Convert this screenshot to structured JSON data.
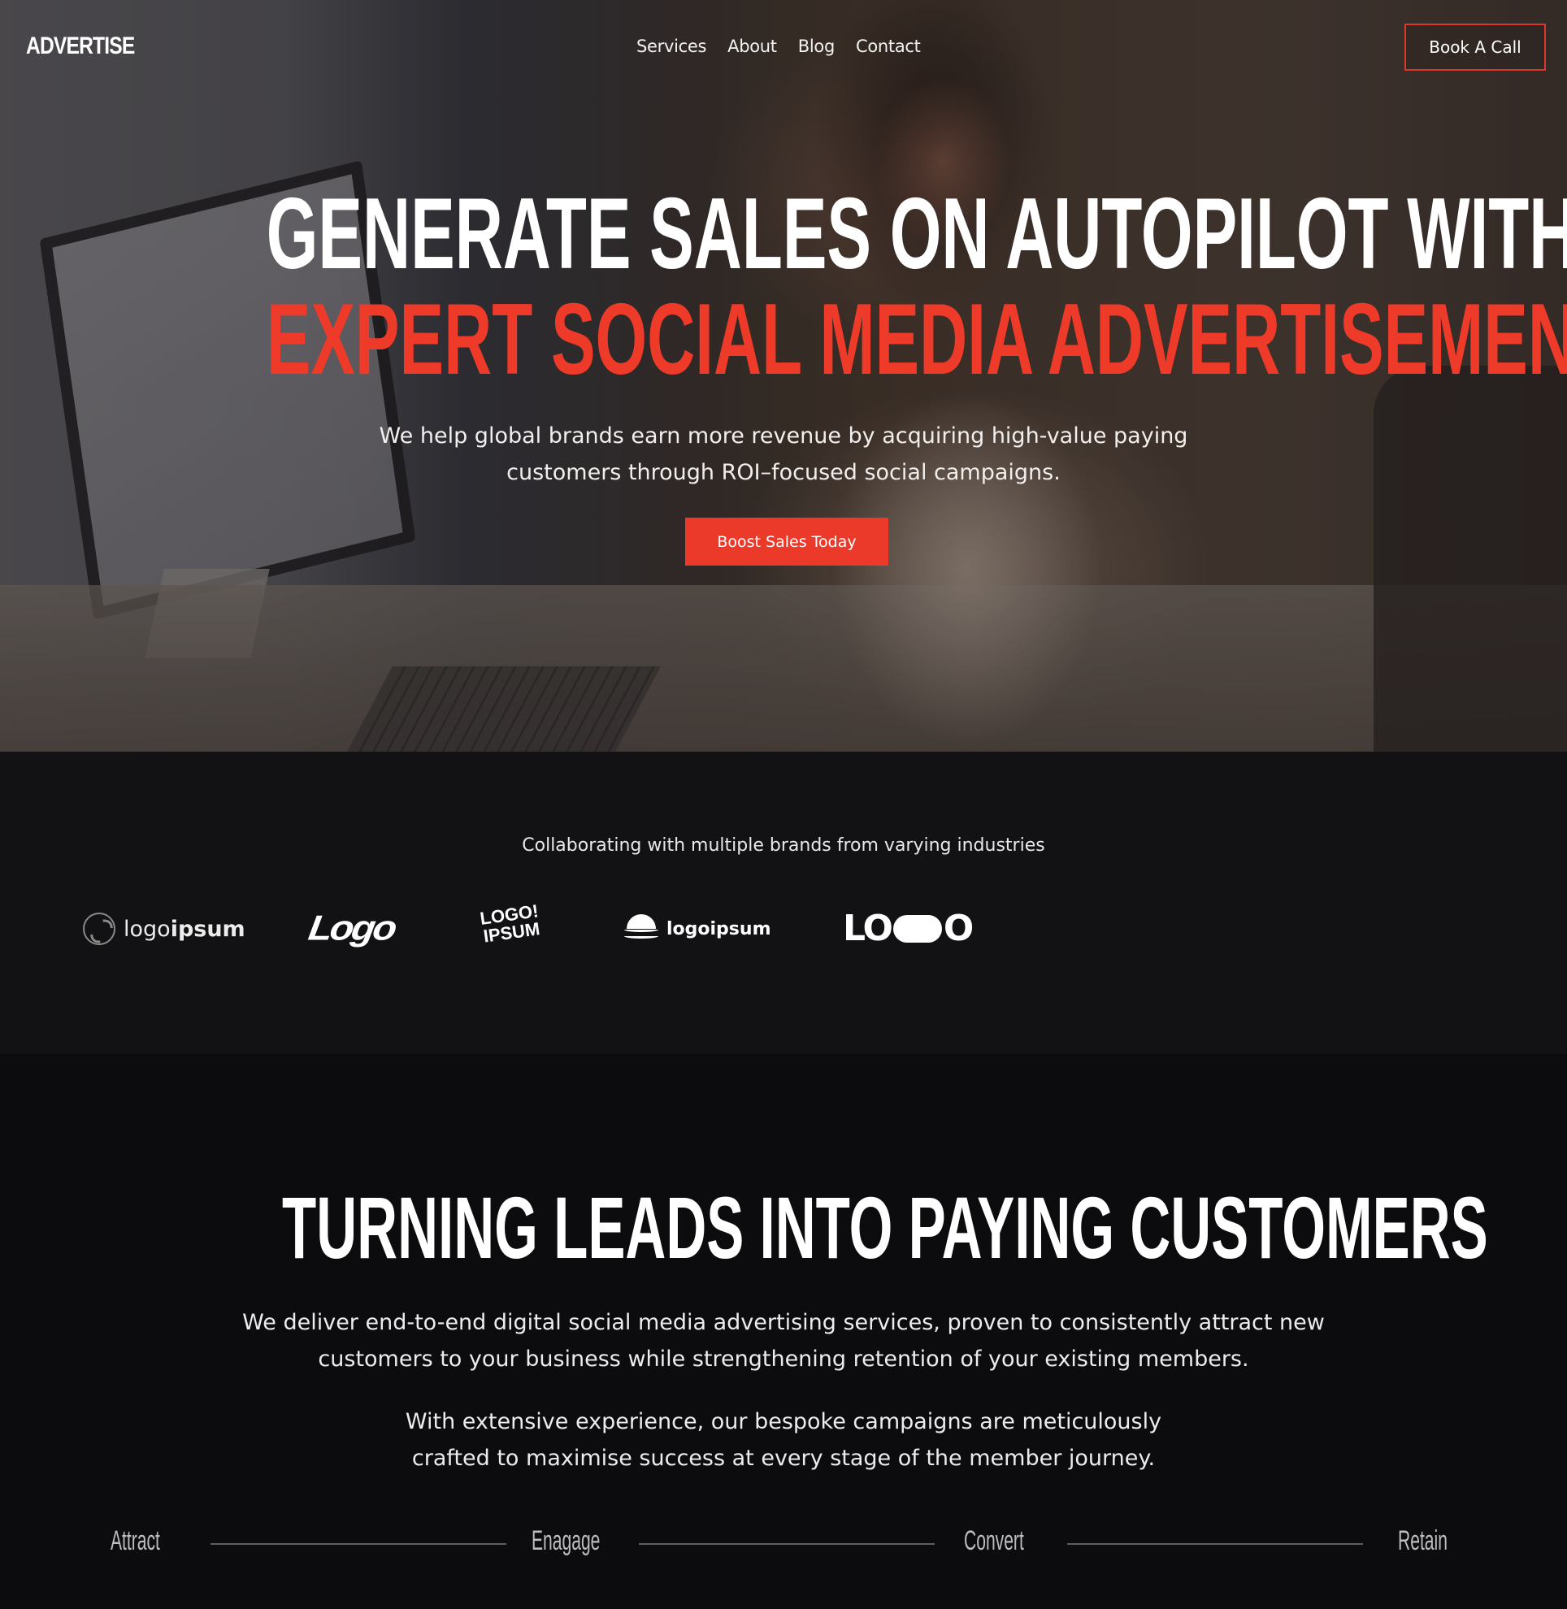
{
  "brand": {
    "logo_text": "ADVERTISE"
  },
  "nav": {
    "links": [
      {
        "label": "Services"
      },
      {
        "label": "About"
      },
      {
        "label": "Blog"
      },
      {
        "label": "Contact"
      }
    ],
    "cta_label": "Book A Call"
  },
  "hero": {
    "headline_line1": "Generate Sales on Autopilot with",
    "headline_line2": "Expert Social Media Advertisement",
    "subtext": "We help global brands earn more revenue by acquiring high-value paying customers through ROI–focused social campaigns.",
    "cta_label": "Boost Sales Today",
    "background_image": "woman-typing-at-desktop-computer"
  },
  "brands": {
    "caption": "Collaborating with multiple brands from varying industries",
    "logos": [
      {
        "text_light": "logo",
        "text_bold": "ipsum",
        "icon": "coffee-bean-ring-icon"
      },
      {
        "text": "Logo"
      },
      {
        "line1": "LOGO!",
        "line2": "IPSUM"
      },
      {
        "text": "logoipsum",
        "icon": "waves-dome-icon"
      },
      {
        "text_left": "LO",
        "text_right": "O"
      }
    ]
  },
  "leads": {
    "title": "Turning Leads Into Paying Customers",
    "paragraph1": "We deliver end-to-end digital social media advertising services, proven to consistently attract new customers to your business while strengthening retention of your existing members.",
    "paragraph2": "With extensive experience, our bespoke campaigns are meticulously crafted to maximise success at every stage of the member journey.",
    "stages": [
      {
        "label": "Attract"
      },
      {
        "label": "Enagage"
      },
      {
        "label": "Convert"
      },
      {
        "label": "Retain"
      }
    ]
  },
  "colors": {
    "accent": "#ec3a2a",
    "hero_overlay": "#141010",
    "brands_bg": "#121114",
    "leads_bg": "#0c0b0e",
    "text": "#ffffff"
  }
}
